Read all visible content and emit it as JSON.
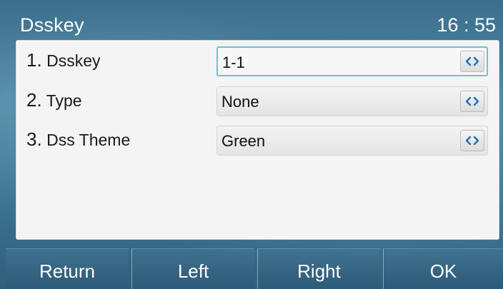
{
  "header": {
    "title": "Dsskey",
    "time": "16 : 55"
  },
  "rows": [
    {
      "number": "1.",
      "label": "Dsskey",
      "value": "1-1"
    },
    {
      "number": "2.",
      "label": "Type",
      "value": "None"
    },
    {
      "number": "3.",
      "label": "Dss Theme",
      "value": "Green"
    }
  ],
  "softkeys": {
    "return_label": "Return",
    "left_label": "Left",
    "right_label": "Right",
    "ok_label": "OK"
  },
  "colors": {
    "accent": "#6fc2c9",
    "switch_arrow": "#1d6fb3",
    "background": "#4a87a6"
  },
  "icons": {
    "switch": "left-right-arrows-icon"
  }
}
